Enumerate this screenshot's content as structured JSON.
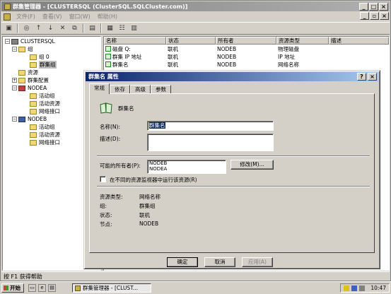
{
  "window": {
    "title": "群集管理器 - [CLUSTERSQL (ClusterSQL.SQLCluster.com)]",
    "controls": {
      "min": "_",
      "max": "□",
      "close": "×"
    }
  },
  "menu": {
    "items": [
      "文件(F)",
      "查看(V)",
      "窗口(W)",
      "帮助(H)"
    ],
    "mdi_controls": {
      "min": "_",
      "restore": "▫",
      "close": "×"
    }
  },
  "toolbar": {
    "icons": [
      "cluster-open-icon",
      "properties-icon",
      "bring-online-icon",
      "take-offline-icon",
      "delete-icon",
      "new-icon",
      "refresh-icon",
      "large-icons-icon",
      "small-icons-icon",
      "details-icon"
    ]
  },
  "tree": {
    "root": "CLUSTERSQL",
    "groups": "组",
    "group0": "组 0",
    "cluster_group": "群集组",
    "resources": "资源",
    "cluster_config": "群集配置",
    "nodea": "NODEA",
    "nodea_active_groups": "活动组",
    "nodea_active_resources": "活动资源",
    "nodea_network_interfaces": "网络接口",
    "nodeb": "NODEB",
    "nodeb_active_groups": "活动组",
    "nodeb_active_resources": "活动资源",
    "nodeb_network_interfaces": "网络接口"
  },
  "list": {
    "columns": [
      "名称",
      "状态",
      "所有者",
      "资源类型",
      "描述"
    ],
    "rows": [
      {
        "name": "磁盘 Q:",
        "state": "联机",
        "owner": "NODEB",
        "type": "物理磁盘",
        "desc": ""
      },
      {
        "name": "群集 IP 地址",
        "state": "联机",
        "owner": "NODEB",
        "type": "IP 地址",
        "desc": ""
      },
      {
        "name": "群集名",
        "state": "联机",
        "owner": "NODEB",
        "type": "网络名称",
        "desc": ""
      }
    ]
  },
  "status": {
    "text": "按 F1 获得帮助"
  },
  "dialog": {
    "title": "群集名 属性",
    "help": "?",
    "close": "×",
    "tabs": [
      "常规",
      "依存",
      "高级",
      "参数"
    ],
    "resource_display_name": "群集名",
    "name_label": "名称(N):",
    "name_value": "群集名",
    "desc_label": "描述(D):",
    "desc_value": "",
    "owners_label": "可能的所有者(P):",
    "owners": [
      "NODEB",
      "NODEA"
    ],
    "modify_button": "修改(M)...",
    "separate_monitor_label": "在不同的资源监视器中运行该资源(R)",
    "info": [
      {
        "label": "资源类型:",
        "value": "网络名称"
      },
      {
        "label": "组:",
        "value": "群集组"
      },
      {
        "label": "状态:",
        "value": "联机"
      },
      {
        "label": "节点:",
        "value": "NODEB"
      }
    ],
    "ok": "确定",
    "cancel": "取消",
    "apply": "应用(A)"
  },
  "taskbar": {
    "start": "开始",
    "task": "群集管理器 - [CLUST...",
    "clock": "10:47"
  }
}
